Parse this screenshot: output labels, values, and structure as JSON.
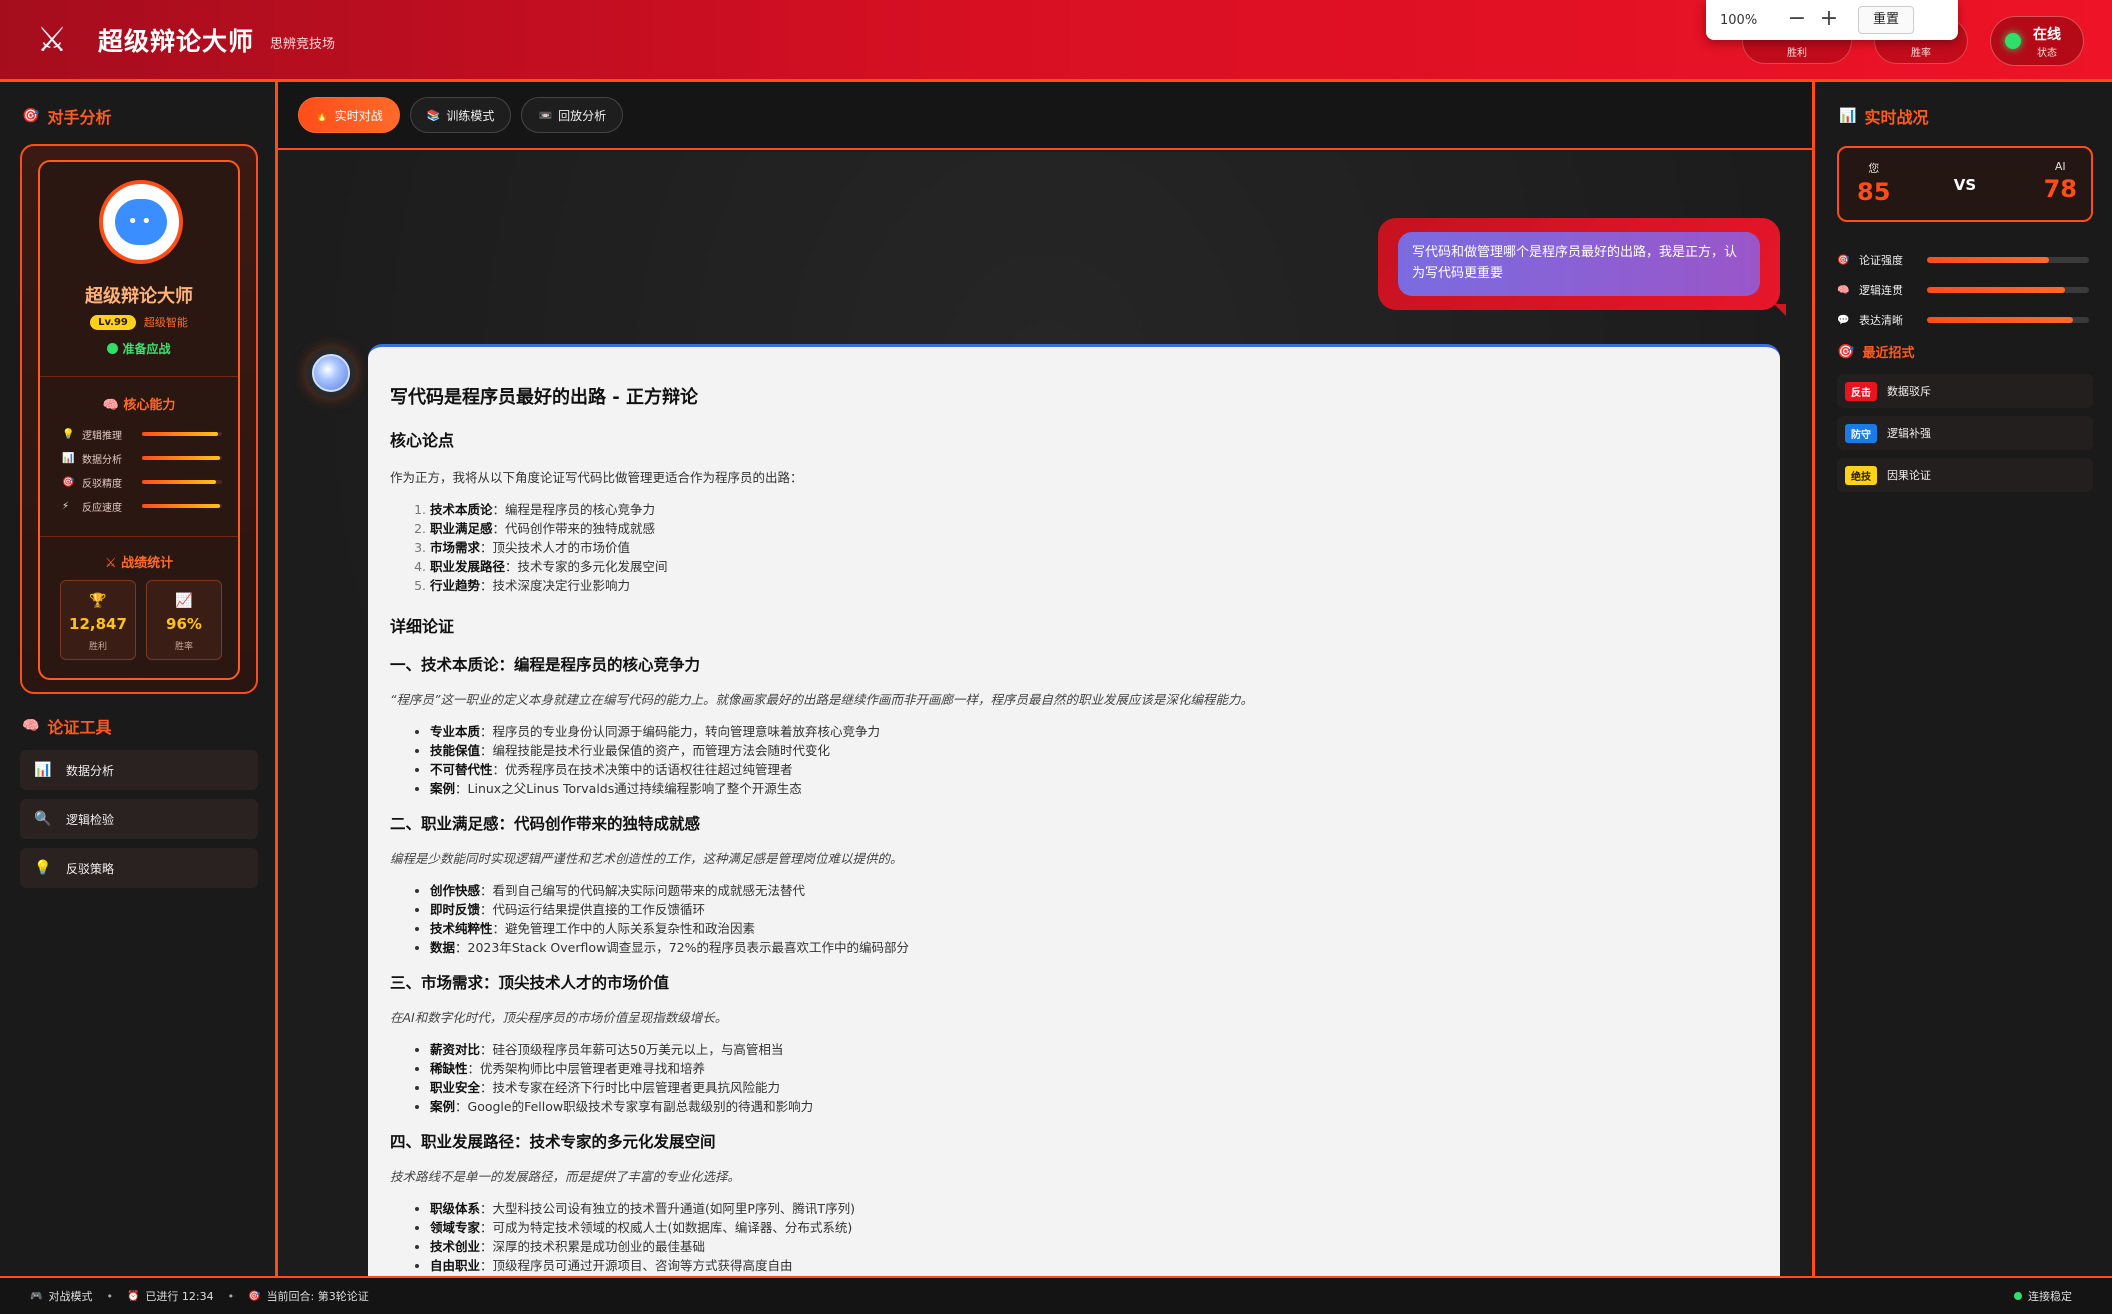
{
  "header": {
    "logo_icon": "crossed-swords-icon",
    "title": "超级辩论大师",
    "subtitle": "思辨竞技场",
    "stats": [
      {
        "icon": "trophy-icon",
        "label": "胜利"
      },
      {
        "icon": "chart-icon",
        "label": "胜率"
      }
    ],
    "online": {
      "label": "在线",
      "sub": "状态"
    }
  },
  "zoom": {
    "percent": "100%",
    "minus": "−",
    "plus": "+",
    "reset": "重置"
  },
  "left": {
    "opponent_title": "对手分析",
    "name": "超级辩论大师",
    "level": "Lv.99",
    "level_text": "超级智能",
    "status": "准备应战",
    "abilities_title": "核心能力",
    "abilities": [
      {
        "icon": "💡",
        "label": "逻辑推理",
        "value": 0.95
      },
      {
        "icon": "📊",
        "label": "数据分析",
        "value": 0.98
      },
      {
        "icon": "🎯",
        "label": "反驳精度",
        "value": 0.92
      },
      {
        "icon": "⚡",
        "label": "反应速度",
        "value": 0.97
      }
    ],
    "stats_title": "战绩统计",
    "stats": [
      {
        "icon": "🏆",
        "value": "12,847",
        "label": "胜利"
      },
      {
        "icon": "📈",
        "value": "96%",
        "label": "胜率"
      }
    ],
    "tools_title": "论证工具",
    "tools": [
      {
        "icon": "📊",
        "label": "数据分析"
      },
      {
        "icon": "🔍",
        "label": "逻辑检验"
      },
      {
        "icon": "💡",
        "label": "反驳策略"
      }
    ]
  },
  "tabs": [
    {
      "icon": "🔥",
      "label": "实时对战"
    },
    {
      "icon": "📚",
      "label": "训练模式"
    },
    {
      "icon": "📼",
      "label": "回放分析"
    }
  ],
  "chat": {
    "user_message": "写代码和做管理哪个是程序员最好的出路，我是正方，认为写代码更重要",
    "title": "写代码是程序员最好的出路 - 正方辩论",
    "h_core": "核心论点",
    "intro": "作为正方，我将从以下角度论证写代码比做管理更适合作为程序员的出路：",
    "core_points": [
      {
        "b": "技术本质论",
        "t": "：编程是程序员的核心竞争力"
      },
      {
        "b": "职业满足感",
        "t": "：代码创作带来的独特成就感"
      },
      {
        "b": "市场需求",
        "t": "：顶尖技术人才的市场价值"
      },
      {
        "b": "职业发展路径",
        "t": "：技术专家的多元化发展空间"
      },
      {
        "b": "行业趋势",
        "t": "：技术深度决定行业影响力"
      }
    ],
    "h_detail": "详细论证",
    "sections": [
      {
        "title": "一、技术本质论：编程是程序员的核心竞争力",
        "quote": "“程序员”这一职业的定义本身就建立在编写代码的能力上。就像画家最好的出路是继续作画而非开画廊一样，程序员最自然的职业发展应该是深化编程能力。",
        "items": [
          {
            "b": "专业本质",
            "t": "：程序员的专业身份认同源于编码能力，转向管理意味着放弃核心竞争力"
          },
          {
            "b": "技能保值",
            "t": "：编程技能是技术行业最保值的资产，而管理方法会随时代变化"
          },
          {
            "b": "不可替代性",
            "t": "：优秀程序员在技术决策中的话语权往往超过纯管理者"
          },
          {
            "b": "案例",
            "t": "：Linux之父Linus Torvalds通过持续编程影响了整个开源生态"
          }
        ]
      },
      {
        "title": "二、职业满足感：代码创作带来的独特成就感",
        "quote": "编程是少数能同时实现逻辑严谨性和艺术创造性的工作，这种满足感是管理岗位难以提供的。",
        "items": [
          {
            "b": "创作快感",
            "t": "：看到自己编写的代码解决实际问题带来的成就感无法替代"
          },
          {
            "b": "即时反馈",
            "t": "：代码运行结果提供直接的工作反馈循环"
          },
          {
            "b": "技术纯粹性",
            "t": "：避免管理工作中的人际关系复杂性和政治因素"
          },
          {
            "b": "数据",
            "t": "：2023年Stack Overflow调查显示，72%的程序员表示最喜欢工作中的编码部分"
          }
        ]
      },
      {
        "title": "三、市场需求：顶尖技术人才的市场价值",
        "quote": "在AI和数字化时代，顶尖程序员的市场价值呈现指数级增长。",
        "items": [
          {
            "b": "薪资对比",
            "t": "：硅谷顶级程序员年薪可达50万美元以上，与高管相当"
          },
          {
            "b": "稀缺性",
            "t": "：优秀架构师比中层管理者更难寻找和培养"
          },
          {
            "b": "职业安全",
            "t": "：技术专家在经济下行时比中层管理者更具抗风险能力"
          },
          {
            "b": "案例",
            "t": "：Google的Fellow职级技术专家享有副总裁级别的待遇和影响力"
          }
        ]
      },
      {
        "title": "四、职业发展路径：技术专家的多元化发展空间",
        "quote": "技术路线不是单一的发展路径，而是提供了丰富的专业化选择。",
        "items": [
          {
            "b": "职级体系",
            "t": "：大型科技公司设有独立的技术晋升通道(如阿里P序列、腾讯T序列)"
          },
          {
            "b": "领域专家",
            "t": "：可成为特定技术领域的权威人士(如数据库、编译器、分布式系统)"
          },
          {
            "b": "技术创业",
            "t": "：深厚的技术积累是成功创业的最佳基础"
          },
          {
            "b": "自由职业",
            "t": "：顶级程序员可通过开源项目、咨询等方式获得高度自由"
          }
        ]
      }
    ]
  },
  "right": {
    "title": "实时战况",
    "you_label": "您",
    "you_score": "85",
    "vs": "VS",
    "ai_label": "AI",
    "ai_score": "78",
    "metrics": [
      {
        "icon": "🎯",
        "label": "论证强度",
        "value": 0.75
      },
      {
        "icon": "🧠",
        "label": "逻辑连贯",
        "value": 0.85
      },
      {
        "icon": "💬",
        "label": "表达清晰",
        "value": 0.9
      }
    ],
    "moves_title": "最近招式",
    "moves": [
      {
        "tag": "反击",
        "tag_color": "#e8141f",
        "tag_text_color": "#ffffff",
        "label": "数据驳斥"
      },
      {
        "tag": "防守",
        "tag_color": "#1a7ae8",
        "tag_text_color": "#ffffff",
        "label": "逻辑补强"
      },
      {
        "tag": "绝技",
        "tag_color": "#ffd21a",
        "tag_text_color": "#2a1a00",
        "label": "因果论证"
      }
    ]
  },
  "status_bar": {
    "mode": "对战模式",
    "elapsed": "已进行 12:34",
    "round": "当前回合: 第3轮论证",
    "connection": "连接稳定"
  }
}
